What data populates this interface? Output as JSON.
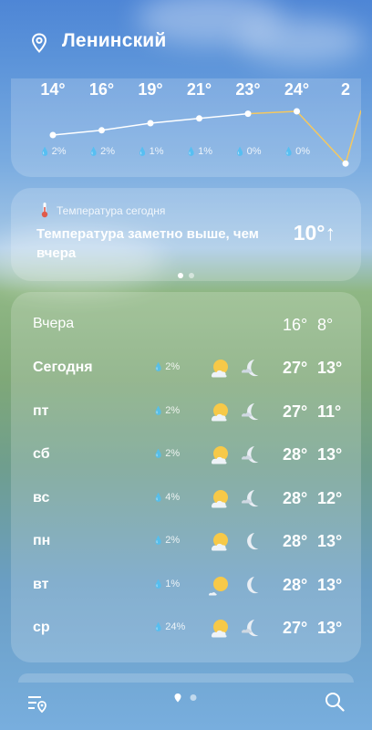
{
  "location": {
    "name": "Ленинский"
  },
  "hourly": [
    {
      "temp": "14°",
      "precip": "2%"
    },
    {
      "temp": "16°",
      "precip": "2%"
    },
    {
      "temp": "19°",
      "precip": "1%"
    },
    {
      "temp": "21°",
      "precip": "1%"
    },
    {
      "temp": "23°",
      "precip": "0%"
    },
    {
      "temp": "24°",
      "precip": "0%"
    },
    {
      "temp": "2",
      "precip": ""
    }
  ],
  "today_card": {
    "label": "Температура сегодня",
    "text": "Температура заметно выше, чем вчера",
    "value": "10°↑",
    "pages": 2,
    "active_page": 1
  },
  "forecast": {
    "yesterday": {
      "day": "Вчера",
      "max": "16°",
      "min": "8°"
    },
    "days": [
      {
        "day": "Сегодня",
        "precip": "2%",
        "day_icon": "partly-cloudy-sun-icon",
        "night_icon": "cloudy-moon-icon",
        "max": "27°",
        "min": "13°"
      },
      {
        "day": "пт",
        "precip": "2%",
        "day_icon": "partly-cloudy-sun-icon",
        "night_icon": "cloudy-moon-icon",
        "max": "27°",
        "min": "11°"
      },
      {
        "day": "сб",
        "precip": "2%",
        "day_icon": "partly-cloudy-sun-icon",
        "night_icon": "cloudy-moon-icon",
        "max": "28°",
        "min": "13°"
      },
      {
        "day": "вс",
        "precip": "4%",
        "day_icon": "partly-cloudy-sun-icon",
        "night_icon": "cloudy-moon-icon",
        "max": "28°",
        "min": "12°"
      },
      {
        "day": "пн",
        "precip": "2%",
        "day_icon": "partly-cloudy-sun-icon",
        "night_icon": "moon-icon",
        "max": "28°",
        "min": "13°"
      },
      {
        "day": "вт",
        "precip": "1%",
        "day_icon": "sun-small-cloud-icon",
        "night_icon": "moon-icon",
        "max": "28°",
        "min": "13°"
      },
      {
        "day": "ср",
        "precip": "24%",
        "day_icon": "partly-cloudy-sun-icon",
        "night_icon": "cloudy-moon-icon",
        "max": "27°",
        "min": "13°"
      }
    ]
  },
  "colors": {
    "temp_line_warm": "#f4c860",
    "temp_line_cool": "#ffffff"
  }
}
